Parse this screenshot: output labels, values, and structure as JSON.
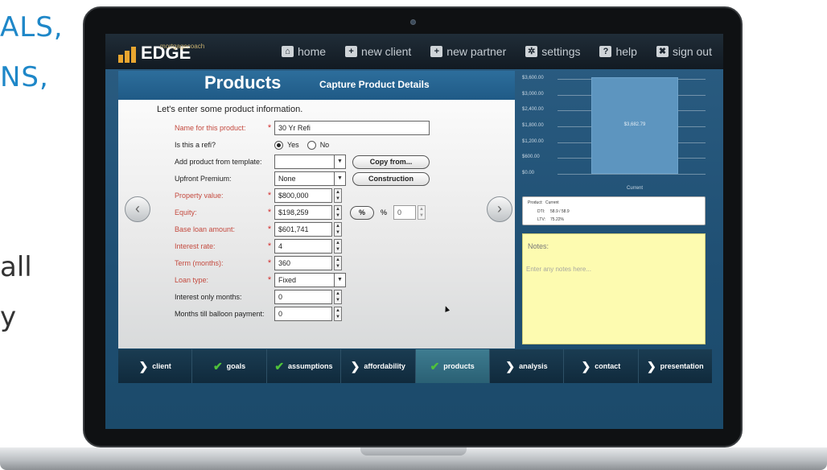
{
  "background_text": {
    "line1": "ALS,",
    "line2": "NS,",
    "line3": "all",
    "line4": "y"
  },
  "app": {
    "logo_small": "mortgagecoach",
    "logo_main": "EDGE"
  },
  "nav": [
    {
      "label": "home",
      "icon": "home-icon"
    },
    {
      "label": "new client",
      "icon": "plus-icon"
    },
    {
      "label": "new partner",
      "icon": "plus-icon"
    },
    {
      "label": "settings",
      "icon": "gear-icon"
    },
    {
      "label": "help",
      "icon": "help-icon"
    },
    {
      "label": "sign out",
      "icon": "close-icon"
    }
  ],
  "page": {
    "title": "Products",
    "subtitle": "Capture Product Details",
    "intro": "Let's enter some product information."
  },
  "form": {
    "name_label": "Name for this product:",
    "name_value": "30 Yr Refi",
    "refi_label": "Is this a refi?",
    "refi_yes": "Yes",
    "refi_no": "No",
    "template_label": "Add product from template:",
    "template_value": "",
    "copy_button": "Copy from...",
    "premium_label": "Upfront Premium:",
    "premium_value": "None",
    "construction_button": "Construction",
    "property_label": "Property value:",
    "property_value": "$800,000",
    "equity_label": "Equity:",
    "equity_value": "$198,259",
    "percent_button": "%",
    "percent_sign": "%",
    "percent_value": "0",
    "base_loan_label": "Base loan amount:",
    "base_loan_value": "$601,741",
    "rate_label": "Interest rate:",
    "rate_value": "4",
    "term_label": "Term (months):",
    "term_value": "360",
    "loan_type_label": "Loan type:",
    "loan_type_value": "Fixed",
    "io_label": "Interest only months:",
    "io_value": "0",
    "balloon_label": "Months till balloon payment:",
    "balloon_value": "0"
  },
  "chart_data": {
    "type": "bar",
    "categories": [
      "Current"
    ],
    "values": [
      3682.79
    ],
    "data_labels": [
      "$3,682.79"
    ],
    "yticks": [
      "$3,600.00",
      "$3,000.00",
      "$2,400.00",
      "$1,800.00",
      "$1,200.00",
      "$600.00",
      "$0.00"
    ],
    "ylim": [
      0,
      3600
    ],
    "bar_color": "#5d95bf"
  },
  "summary": {
    "product_label": "Product:",
    "product_value": "Current",
    "dti_label": "DTI:",
    "dti_value": "58.9 / 58.9",
    "ltv_label": "LTV:",
    "ltv_value": "75.22%"
  },
  "notes": {
    "label": "Notes:",
    "placeholder": "Enter any notes here..."
  },
  "tabs": [
    {
      "label": "client",
      "marker": "chevron",
      "active": false
    },
    {
      "label": "goals",
      "marker": "check",
      "active": false
    },
    {
      "label": "assumptions",
      "marker": "check",
      "active": false
    },
    {
      "label": "affordability",
      "marker": "chevron",
      "active": false
    },
    {
      "label": "products",
      "marker": "check",
      "active": true
    },
    {
      "label": "analysis",
      "marker": "chevron",
      "active": false
    },
    {
      "label": "contact",
      "marker": "chevron",
      "active": false
    },
    {
      "label": "presentation",
      "marker": "chevron",
      "active": false
    }
  ],
  "colors": {
    "accent_blue": "#1e87c8",
    "required_red": "#c44a3f",
    "check_green": "#4fc23a",
    "notes_yellow": "#fdfbb0"
  }
}
